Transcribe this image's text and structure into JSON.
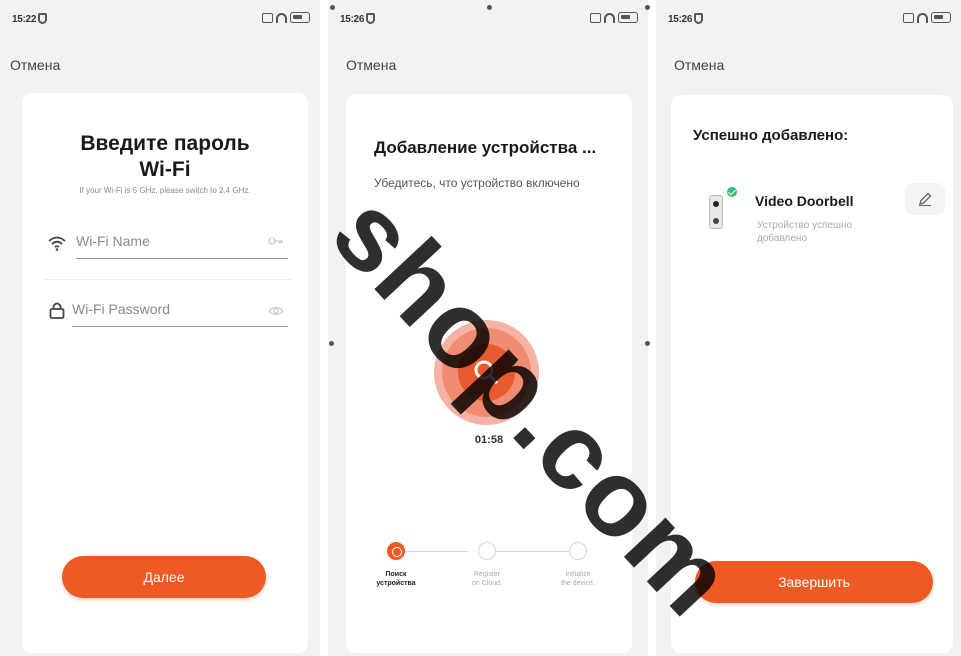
{
  "screens": [
    {
      "status_time": "15:22",
      "cancel": "Отмена",
      "title_line1": "Введите пароль",
      "title_line2": "Wi-Fi",
      "hint": "If your Wi-Fi is 5 GHz, please switch to 2.4 GHz.",
      "wifi_name_placeholder": "Wi-Fi Name",
      "wifi_password_placeholder": "Wi-Fi Password",
      "next_button": "Далее"
    },
    {
      "status_time": "15:26",
      "cancel": "Отмена",
      "title": "Добавление устройства ...",
      "subtitle": "Убедитесь, что устройство включено",
      "timer": "01:58",
      "steps": [
        {
          "line1": "Поиск",
          "line2": "устройства",
          "state": "active"
        },
        {
          "line1": "Register",
          "line2": "on Cloud.",
          "state": "pending"
        },
        {
          "line1": "Initialize",
          "line2": "the device.",
          "state": "pending"
        }
      ]
    },
    {
      "status_time": "15:26",
      "cancel": "Отмена",
      "title": "Успешно добавлено:",
      "device_name": "Video Doorbell",
      "device_status_line1": "Устройство успешно",
      "device_status_line2": "добавлено",
      "finish_button": "Завершить"
    }
  ],
  "watermark": "shop.com",
  "colors": {
    "accent": "#ef5a24",
    "success": "#2fbf71",
    "background": "#f2f2f2",
    "card": "#ffffff"
  },
  "icons": [
    "wifi-icon",
    "lock-icon",
    "eye-icon",
    "key-icon",
    "search-icon",
    "pencil-icon",
    "check-icon"
  ]
}
